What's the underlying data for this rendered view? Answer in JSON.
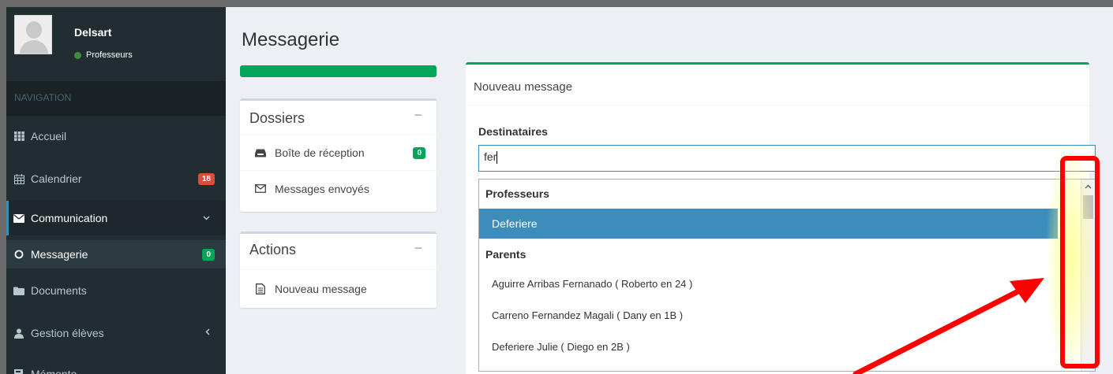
{
  "user": {
    "name": "Delsart",
    "role": "Professeurs"
  },
  "nav": {
    "header": "NAVIGATION",
    "items": [
      {
        "label": "Accueil",
        "icon": "grid-icon"
      },
      {
        "label": "Calendrier",
        "icon": "calendar-icon",
        "badge": "18"
      },
      {
        "label": "Communication",
        "icon": "envelope-icon"
      },
      {
        "label": "Messagerie",
        "icon": "circle-icon",
        "badge": "0"
      },
      {
        "label": "Documents",
        "icon": "folder-icon"
      },
      {
        "label": "Gestion élèves",
        "icon": "user-icon"
      },
      {
        "label": "Mémento",
        "icon": "book-icon"
      }
    ]
  },
  "page": {
    "title": "Messagerie"
  },
  "folders": {
    "title": "Dossiers",
    "items": [
      {
        "label": "Boîte de réception",
        "badge": "0"
      },
      {
        "label": "Messages envoyés"
      }
    ]
  },
  "actions": {
    "title": "Actions",
    "items": [
      {
        "label": "Nouveau message"
      }
    ]
  },
  "compose": {
    "title": "Nouveau message",
    "recipients_label": "Destinataires",
    "search_value": "fer",
    "groups": [
      {
        "label": "Professeurs",
        "options": [
          "Deferiere"
        ]
      },
      {
        "label": "Parents",
        "options": [
          "Aguirre Arribas Fernanado ( Roberto en 24 )",
          "Carreno Fernandez Magali ( Dany en 1B )",
          "Deferiere Julie ( Diego en 2B )"
        ]
      }
    ]
  },
  "colors": {
    "sidebar": "#222d32",
    "accent": "#3c8dbc",
    "success": "#00a65a",
    "danger": "#dd4b39",
    "annotation": "#ff0000"
  }
}
